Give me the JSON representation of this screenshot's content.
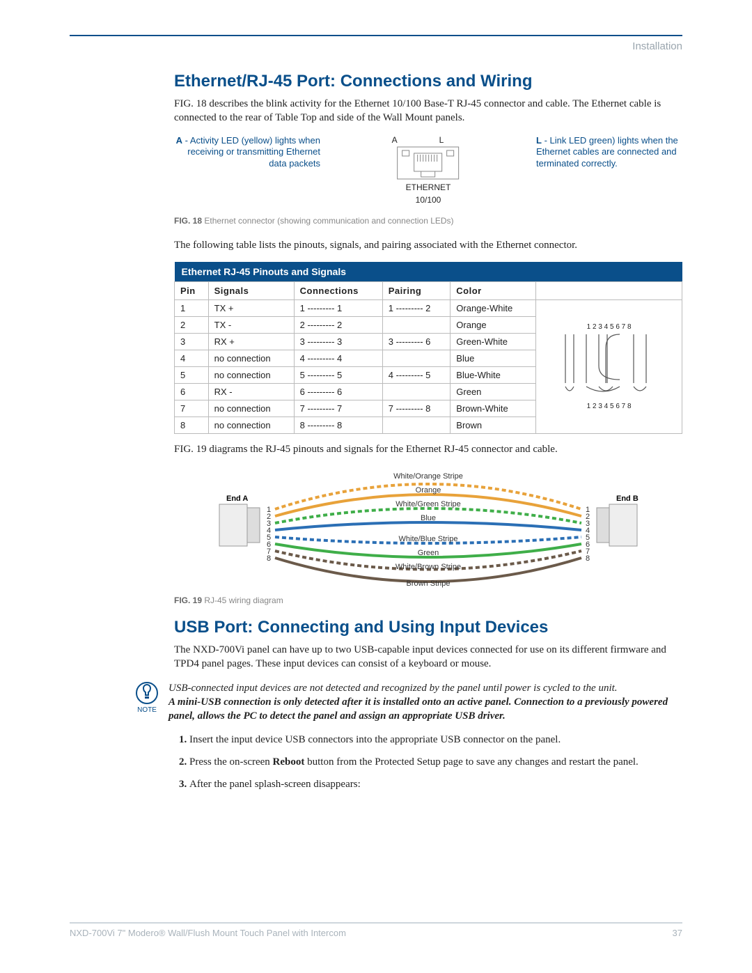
{
  "header": {
    "section": "Installation"
  },
  "h1": "Ethernet/RJ-45 Port: Connections and Wiring",
  "p1": "FIG. 18 describes the blink activity for the Ethernet 10/100 Base-T RJ-45 connector and cable. The Ethernet cable is connected to the rear of Table Top and side of the Wall Mount panels.",
  "fig18": {
    "left_bold": "A",
    "left_text": " - Activity LED (yellow) lights when receiving or transmitting Ethernet data packets",
    "right_bold": "L",
    "right_text": " - Link LED green) lights when the Ethernet cables are connected and terminated correctly.",
    "label_A": "A",
    "label_L": "L",
    "eth1": "ETHERNET",
    "eth2": "10/100",
    "caption_bold": "FIG. 18",
    "caption_text": "  Ethernet connector (showing communication and connection LEDs)"
  },
  "p2": "The following table lists the pinouts, signals, and pairing associated with the Ethernet connector.",
  "table": {
    "title": "Ethernet RJ-45 Pinouts and Signals",
    "cols": [
      "Pin",
      "Signals",
      "Connections",
      "Pairing",
      "Color"
    ],
    "rows": [
      [
        "1",
        "TX +",
        "1 --------- 1",
        "1 --------- 2",
        "Orange-White"
      ],
      [
        "2",
        "TX -",
        "2 --------- 2",
        "",
        "Orange"
      ],
      [
        "3",
        "RX +",
        "3 --------- 3",
        "3 --------- 6",
        "Green-White"
      ],
      [
        "4",
        "no connection",
        "4 --------- 4",
        "",
        "Blue"
      ],
      [
        "5",
        "no connection",
        "5 --------- 5",
        "4 --------- 5",
        "Blue-White"
      ],
      [
        "6",
        "RX -",
        "6 --------- 6",
        "",
        "Green"
      ],
      [
        "7",
        "no connection",
        "7 --------- 7",
        "7 --------- 8",
        "Brown-White"
      ],
      [
        "8",
        "no connection",
        "8 --------- 8",
        "",
        "Brown"
      ]
    ],
    "diagram_top": "1 2 3  4 5  6 7 8",
    "diagram_bottom": "1 2  3  4 5  6  7 8"
  },
  "p3": "FIG. 19 diagrams the RJ-45 pinouts and signals for the Ethernet RJ-45 connector and cable.",
  "fig19": {
    "wire_labels": [
      "White/Orange Stripe",
      "Orange",
      "White/Green Stripe",
      "Blue",
      "White/Blue Stripe",
      "Green",
      "White/Brown Stripe",
      "Brown Stripe"
    ],
    "endA": "End A",
    "endB": "End B",
    "pins": [
      "1",
      "2",
      "3",
      "4",
      "5",
      "6",
      "7",
      "8"
    ],
    "caption_bold": "FIG. 19",
    "caption_text": "  RJ-45 wiring diagram"
  },
  "h2": "USB Port: Connecting and Using Input Devices",
  "p4": "The NXD-700Vi panel can have up to two USB-capable input devices connected for use on its different firmware and TPD4 panel pages. These input devices can consist of a keyboard or mouse.",
  "note": {
    "label": "NOTE",
    "line1": "USB-connected input devices are not detected and recognized by the panel until power is cycled to the unit.",
    "line2": "A mini-USB connection is only detected after it is installed onto an active panel. Connection to a previously powered panel, allows the PC to detect the panel and assign an appropriate USB driver."
  },
  "steps": {
    "s1": "Insert the input device USB connectors into the appropriate USB connector on the panel.",
    "s2a": "Press the on-screen ",
    "s2b": "Reboot",
    "s2c": " button from the Protected Setup page to save any changes and restart the panel.",
    "s3": "After the panel splash-screen disappears:"
  },
  "footer": {
    "left": "NXD-700Vi 7\" Modero® Wall/Flush Mount Touch Panel with Intercom",
    "right": "37"
  },
  "chart_data": {
    "type": "table",
    "title": "Ethernet RJ-45 Pinouts and Signals",
    "columns": [
      "Pin",
      "Signals",
      "Connections",
      "Pairing",
      "Color"
    ],
    "rows": [
      {
        "Pin": 1,
        "Signals": "TX +",
        "Connections": "1-1",
        "Pairing": "1-2",
        "Color": "Orange-White"
      },
      {
        "Pin": 2,
        "Signals": "TX -",
        "Connections": "2-2",
        "Pairing": "",
        "Color": "Orange"
      },
      {
        "Pin": 3,
        "Signals": "RX +",
        "Connections": "3-3",
        "Pairing": "3-6",
        "Color": "Green-White"
      },
      {
        "Pin": 4,
        "Signals": "no connection",
        "Connections": "4-4",
        "Pairing": "",
        "Color": "Blue"
      },
      {
        "Pin": 5,
        "Signals": "no connection",
        "Connections": "5-5",
        "Pairing": "4-5",
        "Color": "Blue-White"
      },
      {
        "Pin": 6,
        "Signals": "RX -",
        "Connections": "6-6",
        "Pairing": "",
        "Color": "Green"
      },
      {
        "Pin": 7,
        "Signals": "no connection",
        "Connections": "7-7",
        "Pairing": "7-8",
        "Color": "Brown-White"
      },
      {
        "Pin": 8,
        "Signals": "no connection",
        "Connections": "8-8",
        "Pairing": "",
        "Color": "Brown"
      }
    ]
  }
}
